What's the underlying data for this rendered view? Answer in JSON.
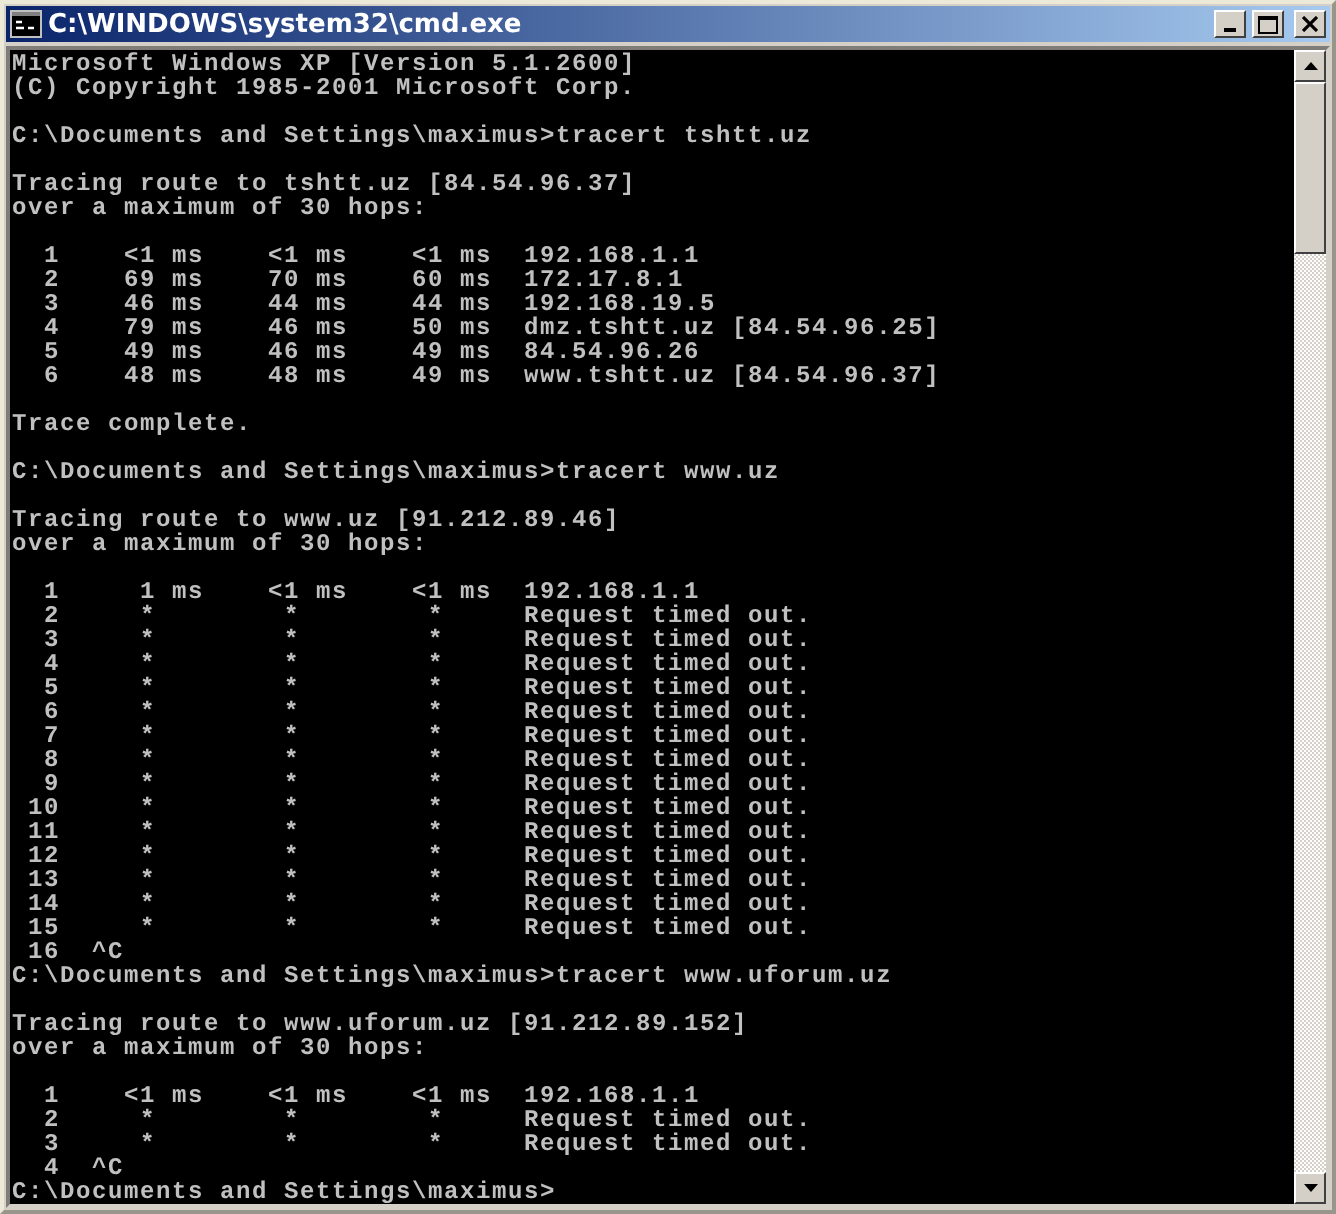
{
  "window": {
    "title": "C:\\WINDOWS\\system32\\cmd.exe"
  },
  "console": {
    "lines": [
      {
        "kind": "text",
        "text": "Microsoft Windows XP [Version 5.1.2600]"
      },
      {
        "kind": "text",
        "text": "(C) Copyright 1985-2001 Microsoft Corp."
      },
      {
        "kind": "blank"
      },
      {
        "kind": "text",
        "text": "C:\\Documents and Settings\\maximus>tracert tshtt.uz"
      },
      {
        "kind": "blank"
      },
      {
        "kind": "text",
        "text": "Tracing route to tshtt.uz [84.54.96.37]"
      },
      {
        "kind": "text",
        "text": "over a maximum of 30 hops:"
      },
      {
        "kind": "blank"
      },
      {
        "kind": "text",
        "text": "  1    <1 ms    <1 ms    <1 ms  192.168.1.1"
      },
      {
        "kind": "text",
        "text": "  2    69 ms    70 ms    60 ms  172.17.8.1"
      },
      {
        "kind": "text",
        "text": "  3    46 ms    44 ms    44 ms  192.168.19.5"
      },
      {
        "kind": "text",
        "text": "  4    79 ms    46 ms    50 ms  dmz.tshtt.uz [84.54.96.25]"
      },
      {
        "kind": "text",
        "text": "  5    49 ms    46 ms    49 ms  84.54.96.26"
      },
      {
        "kind": "text",
        "text": "  6    48 ms    48 ms    49 ms  www.tshtt.uz [84.54.96.37]"
      },
      {
        "kind": "blank"
      },
      {
        "kind": "text",
        "text": "Trace complete."
      },
      {
        "kind": "blank"
      },
      {
        "kind": "text",
        "text": "C:\\Documents and Settings\\maximus>tracert www.uz"
      },
      {
        "kind": "blank"
      },
      {
        "kind": "text",
        "text": "Tracing route to www.uz [91.212.89.46]"
      },
      {
        "kind": "text",
        "text": "over a maximum of 30 hops:"
      },
      {
        "kind": "blank"
      },
      {
        "kind": "text",
        "text": "  1     1 ms    <1 ms    <1 ms  192.168.1.1"
      },
      {
        "kind": "text",
        "text": "  2     *        *        *     Request timed out."
      },
      {
        "kind": "text",
        "text": "  3     *        *        *     Request timed out."
      },
      {
        "kind": "text",
        "text": "  4     *        *        *     Request timed out."
      },
      {
        "kind": "text",
        "text": "  5     *        *        *     Request timed out."
      },
      {
        "kind": "text",
        "text": "  6     *        *        *     Request timed out."
      },
      {
        "kind": "text",
        "text": "  7     *        *        *     Request timed out."
      },
      {
        "kind": "text",
        "text": "  8     *        *        *     Request timed out."
      },
      {
        "kind": "text",
        "text": "  9     *        *        *     Request timed out."
      },
      {
        "kind": "text",
        "text": " 10     *        *        *     Request timed out."
      },
      {
        "kind": "text",
        "text": " 11     *        *        *     Request timed out."
      },
      {
        "kind": "text",
        "text": " 12     *        *        *     Request timed out."
      },
      {
        "kind": "text",
        "text": " 13     *        *        *     Request timed out."
      },
      {
        "kind": "text",
        "text": " 14     *        *        *     Request timed out."
      },
      {
        "kind": "text",
        "text": " 15     *        *        *     Request timed out."
      },
      {
        "kind": "text",
        "text": " 16  ^C"
      },
      {
        "kind": "text",
        "text": "C:\\Documents and Settings\\maximus>tracert www.uforum.uz"
      },
      {
        "kind": "blank"
      },
      {
        "kind": "text",
        "text": "Tracing route to www.uforum.uz [91.212.89.152]"
      },
      {
        "kind": "text",
        "text": "over a maximum of 30 hops:"
      },
      {
        "kind": "blank"
      },
      {
        "kind": "text",
        "text": "  1    <1 ms    <1 ms    <1 ms  192.168.1.1"
      },
      {
        "kind": "text",
        "text": "  2     *        *        *     Request timed out."
      },
      {
        "kind": "text",
        "text": "  3     *        *        *     Request timed out."
      },
      {
        "kind": "text",
        "text": "  4  ^C"
      },
      {
        "kind": "text",
        "text": "C:\\Documents and Settings\\maximus>"
      }
    ]
  }
}
